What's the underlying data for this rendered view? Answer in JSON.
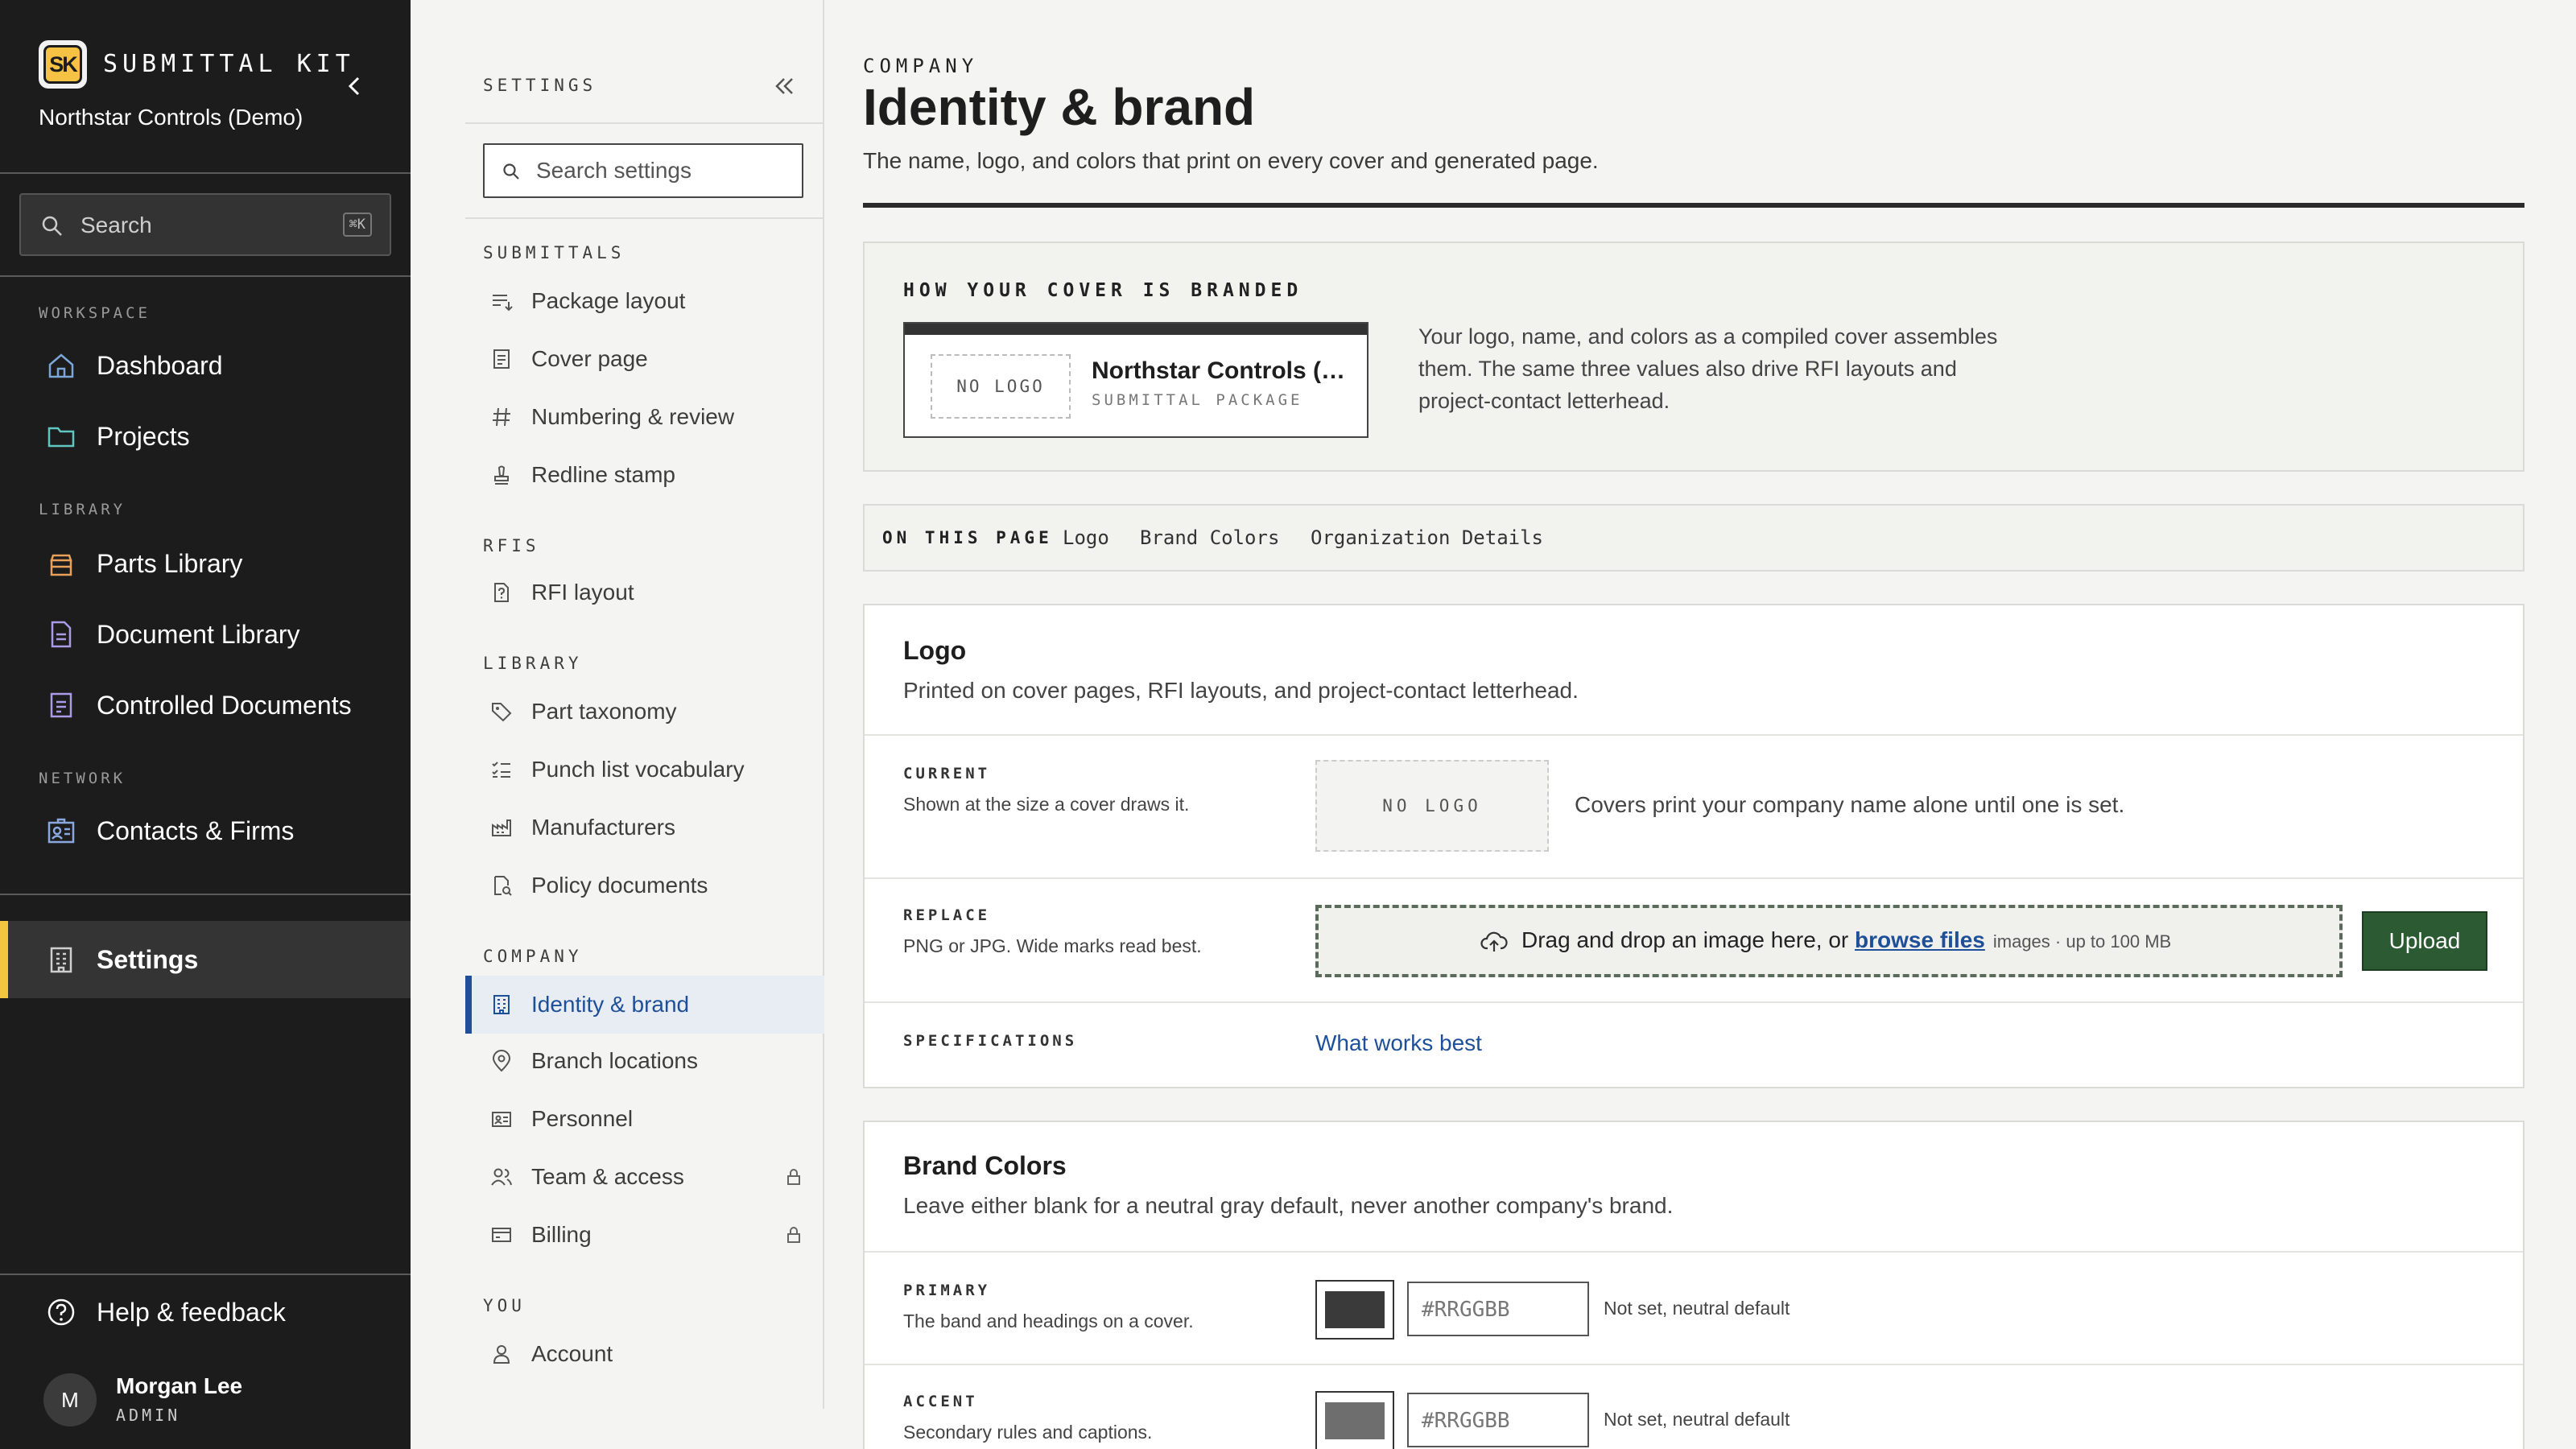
{
  "app": {
    "name": "SUBMITTAL KIT",
    "logo_text": "SK",
    "org": "Northstar Controls (Demo)",
    "search_placeholder": "Search",
    "search_shortcut": "⌘K"
  },
  "nav": {
    "sections": {
      "workspace": "WORKSPACE",
      "library": "LIBRARY",
      "network": "NETWORK"
    },
    "items": [
      {
        "label": "Dashboard",
        "icon": "home-icon"
      },
      {
        "label": "Projects",
        "icon": "folder-icon"
      },
      {
        "label": "Parts Library",
        "icon": "box-icon"
      },
      {
        "label": "Document Library",
        "icon": "document-icon"
      },
      {
        "label": "Controlled Documents",
        "icon": "controlled-document-icon"
      },
      {
        "label": "Contacts & Firms",
        "icon": "id-card-icon"
      },
      {
        "label": "Settings",
        "icon": "building-icon",
        "active": true
      },
      {
        "label": "Help & feedback",
        "icon": "help-icon"
      }
    ],
    "user": {
      "initial": "M",
      "name": "Morgan Lee",
      "role": "ADMIN"
    }
  },
  "settings": {
    "title": "SETTINGS",
    "search_placeholder": "Search settings",
    "groups": {
      "submittals": {
        "label": "SUBMITTALS",
        "items": [
          "Package layout",
          "Cover page",
          "Numbering & review",
          "Redline stamp"
        ]
      },
      "rfis": {
        "label": "RFIS",
        "items": [
          "RFI layout"
        ]
      },
      "library": {
        "label": "LIBRARY",
        "items": [
          "Part taxonomy",
          "Punch list vocabulary",
          "Manufacturers",
          "Policy documents"
        ]
      },
      "company": {
        "label": "COMPANY",
        "items": [
          "Identity & brand",
          "Branch locations",
          "Personnel",
          "Team & access",
          "Billing"
        ]
      },
      "you": {
        "label": "YOU",
        "items": [
          "Account"
        ]
      }
    }
  },
  "page": {
    "eyebrow": "COMPANY",
    "title": "Identity & brand",
    "subtitle": "The name, logo, and colors that print on every cover and generated page.",
    "how": {
      "label": "HOW YOUR COVER IS BRANDED",
      "preview_logo": "NO LOGO",
      "preview_name": "Northstar Controls (Demo)",
      "preview_sub": "SUBMITTAL PACKAGE",
      "description": "Your logo, name, and colors as a compiled cover assembles them. The same three values also drive RFI layouts and project-contact letterhead."
    },
    "on_this_page": {
      "label": "ON THIS PAGE",
      "links": [
        "Logo",
        "Brand Colors",
        "Organization Details"
      ]
    },
    "logo": {
      "title": "Logo",
      "desc": "Printed on cover pages, RFI layouts, and project-contact letterhead.",
      "current_label": "CURRENT",
      "current_desc": "Shown at the size a cover draws it.",
      "current_value": "NO LOGO",
      "current_caption": "Covers print your company name alone until one is set.",
      "replace_label": "REPLACE",
      "replace_desc": "PNG or JPG. Wide marks read best.",
      "drop_text": "Drag and drop an image here, or",
      "drop_link": "browse files",
      "drop_meta": "images · up to 100 MB",
      "upload": "Upload",
      "spec_label": "SPECIFICATIONS",
      "spec_link": "What works best"
    },
    "colors": {
      "title": "Brand Colors",
      "desc": "Leave either blank for a neutral gray default, never another company's brand.",
      "primary_label": "PRIMARY",
      "primary_desc": "The band and headings on a cover.",
      "primary_swatch": "#3a3a3a",
      "primary_placeholder": "#RRGGBB",
      "primary_status": "Not set, neutral default",
      "accent_label": "ACCENT",
      "accent_desc": "Secondary rules and captions.",
      "accent_swatch": "#6e6e6e",
      "accent_placeholder": "#RRGGBB",
      "accent_status": "Not set, neutral default"
    }
  }
}
